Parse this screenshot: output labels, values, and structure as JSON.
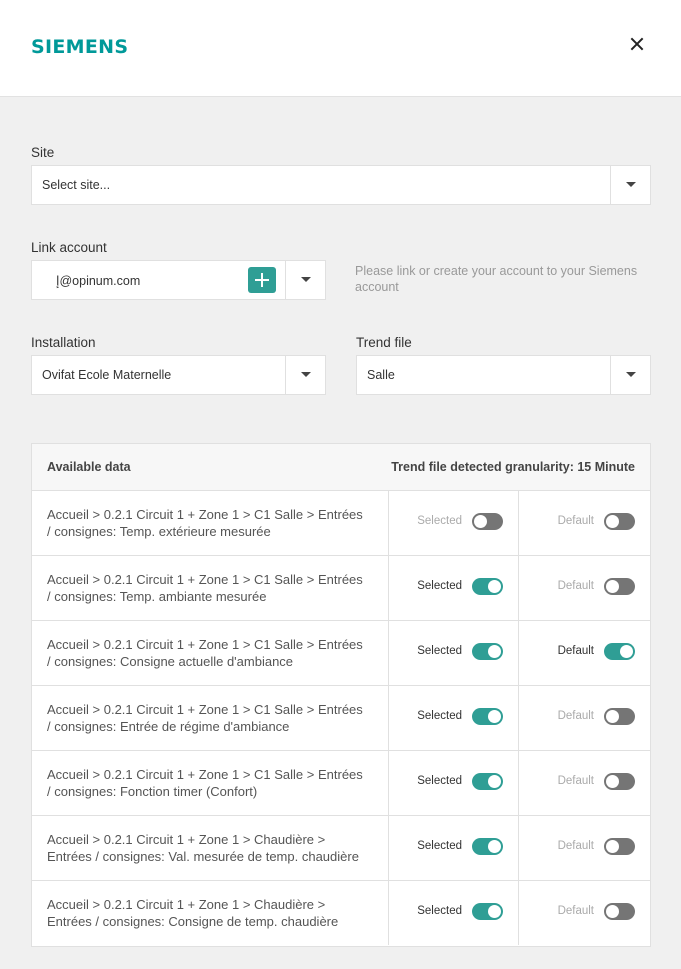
{
  "header": {
    "logo": "SIEMENS"
  },
  "site": {
    "label": "Site",
    "value": "Select site..."
  },
  "link_account": {
    "label": "Link account",
    "value": "إ@opinum.com",
    "hint": "Please link or create your account to your Siemens account"
  },
  "installation": {
    "label": "Installation",
    "value": "Ovifat Ecole Maternelle"
  },
  "trend_file": {
    "label": "Trend file",
    "value": "Salle"
  },
  "table": {
    "header_left": "Available data",
    "header_right": "Trend file detected granularity: 15 Minute",
    "selected_label": "Selected",
    "default_label": "Default",
    "rows": [
      {
        "line1": "Accueil > 0.2.1 Circuit 1 + Zone 1 > C1 Salle > Entrées",
        "line2": "/ consignes: Temp. extérieure mesurée",
        "selected": false,
        "default": false
      },
      {
        "line1": "Accueil > 0.2.1 Circuit 1 + Zone 1 > C1 Salle > Entrées",
        "line2": "/ consignes: Temp. ambiante mesurée",
        "selected": true,
        "default": false
      },
      {
        "line1": "Accueil > 0.2.1 Circuit 1 + Zone 1 > C1 Salle > Entrées",
        "line2": "/ consignes: Consigne actuelle d'ambiance",
        "selected": true,
        "default": true
      },
      {
        "line1": "Accueil > 0.2.1 Circuit 1 + Zone 1 > C1 Salle > Entrées",
        "line2": "/ consignes: Entrée de régime d'ambiance",
        "selected": true,
        "default": false
      },
      {
        "line1": "Accueil > 0.2.1 Circuit 1 + Zone 1 > C1 Salle > Entrées",
        "line2": "/ consignes: Fonction timer (Confort)",
        "selected": true,
        "default": false
      },
      {
        "line1": "Accueil > 0.2.1 Circuit 1 + Zone 1 > Chaudière >",
        "line2": "Entrées / consignes: Val. mesurée de temp. chaudière",
        "selected": true,
        "default": false
      },
      {
        "line1": "Accueil > 0.2.1 Circuit 1 + Zone 1 > Chaudière >",
        "line2": "Entrées / consignes: Consigne de temp. chaudière",
        "selected": true,
        "default": false
      }
    ]
  },
  "colors": {
    "brand": "#009999",
    "toggle_on": "#2f9e95",
    "toggle_off": "#757575"
  },
  "icons": {
    "close": "close-icon",
    "add": "plus-icon",
    "dropdown": "chevron-down-icon"
  }
}
